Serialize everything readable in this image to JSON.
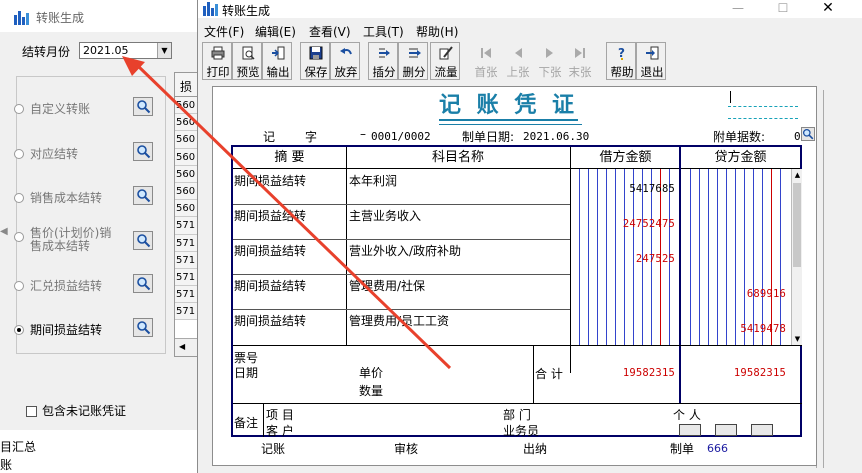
{
  "background_dialog": {
    "title": "转账生成",
    "month_label": "结转月份",
    "month_value": "2021.05",
    "options": [
      {
        "label": "自定义转账",
        "selected": false
      },
      {
        "label": "对应结转",
        "selected": false
      },
      {
        "label": "销售成本结转",
        "selected": false
      },
      {
        "label": "售价(计划价)销售成本结转",
        "selected": false
      },
      {
        "label": "汇兑损益结转",
        "selected": false
      },
      {
        "label": "期间损益结转",
        "selected": true
      }
    ],
    "include_unposted_label": "包含未记账凭证",
    "list_header": "损",
    "list_codes": [
      "560",
      "560",
      "560",
      "560",
      "560",
      "560",
      "560",
      "571",
      "571",
      "571",
      "571",
      "571",
      "571"
    ],
    "bottom_texts": [
      "目汇总",
      "账"
    ]
  },
  "main_window": {
    "title": "转账生成",
    "menu": [
      "文件(F)",
      "编辑(E)",
      "查看(V)",
      "工具(T)",
      "帮助(H)"
    ],
    "toolbar": [
      {
        "label": "打印",
        "icon": "printer-icon",
        "enabled": true
      },
      {
        "label": "预览",
        "icon": "preview-icon",
        "enabled": true
      },
      {
        "label": "输出",
        "icon": "export-icon",
        "enabled": true
      },
      {
        "label": "保存",
        "icon": "save-icon",
        "enabled": true
      },
      {
        "label": "放弃",
        "icon": "undo-icon",
        "enabled": true
      },
      {
        "label": "插分",
        "icon": "insert-entry-icon",
        "enabled": true
      },
      {
        "label": "删分",
        "icon": "delete-entry-icon",
        "enabled": true
      },
      {
        "label": "流量",
        "icon": "cashflow-icon",
        "enabled": true
      },
      {
        "label": "首张",
        "icon": "first-icon",
        "enabled": false
      },
      {
        "label": "上张",
        "icon": "prev-icon",
        "enabled": false
      },
      {
        "label": "下张",
        "icon": "next-icon",
        "enabled": false
      },
      {
        "label": "末张",
        "icon": "last-icon",
        "enabled": false
      },
      {
        "label": "帮助",
        "icon": "help-icon",
        "enabled": true
      },
      {
        "label": "退出",
        "icon": "exit-icon",
        "enabled": true
      }
    ]
  },
  "voucher": {
    "title": "记 账 凭 证",
    "type_label": "记",
    "no_label": "字",
    "number": "0001/0002",
    "number_prefix": "–",
    "date_label": "制单日期:",
    "date": "2021.06.30",
    "attachments_label": "附单据数:",
    "attachments": "0",
    "headers": {
      "summary": "摘 要",
      "account": "科目名称",
      "debit": "借方金额",
      "credit": "贷方金额"
    },
    "entries": [
      {
        "summary": "期间损益结转",
        "account": "本年利润",
        "debit": "5417685",
        "credit": ""
      },
      {
        "summary": "期间损益结转",
        "account": "主营业务收入",
        "debit": "24752475",
        "credit": ""
      },
      {
        "summary": "期间损益结转",
        "account": "营业外收入/政府补助",
        "debit": "247525",
        "credit": ""
      },
      {
        "summary": "期间损益结转",
        "account": "管理费用/社保",
        "debit": "",
        "credit": "689916"
      },
      {
        "summary": "期间损益结转",
        "account": "管理费用/员工工资",
        "debit": "",
        "credit": "5419478"
      }
    ],
    "footer": {
      "ticket_label": "票号",
      "date_label": "日期",
      "price_label": "单价",
      "qty_label": "数量",
      "total_label": "合 计",
      "total_debit": "19582315",
      "total_credit": "19582315"
    },
    "remarks": {
      "label": "备注",
      "project_label": "项 目",
      "dept_label": "部 门",
      "person_label": "个 人",
      "customer_label": "客 户",
      "salesman_label": "业务员"
    },
    "signatures": {
      "posted_label": "记账",
      "audit_label": "审核",
      "cashier_label": "出纳",
      "maker_label": "制单",
      "maker": "666"
    }
  },
  "colors": {
    "title": "#1a7fa8",
    "amount": "#cc0000",
    "grid_border": "#000066",
    "arrow": "#e8412c"
  }
}
